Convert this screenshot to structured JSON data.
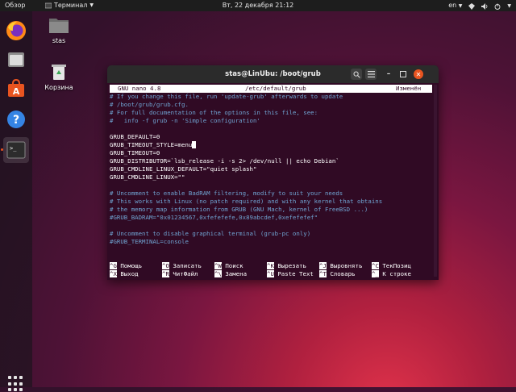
{
  "topbar": {
    "overview": "Обзор",
    "app_name": "Терминал",
    "clock": "Вт, 22 декабря  21:12",
    "lang": "en"
  },
  "desktop": {
    "home_label": "stas",
    "trash_label": "Корзина"
  },
  "window": {
    "title": "stas@LinUbu: /boot/grub"
  },
  "nano": {
    "version": "GNU nano 4.8",
    "file": "/etc/default/grub",
    "status": "Изменён",
    "lines": [
      "# If you change this file, run 'update-grub' afterwards to update",
      "# /boot/grub/grub.cfg.",
      "# For full documentation of the options in this file, see:",
      "#   info -f grub -n 'Simple configuration'",
      "",
      "GRUB_DEFAULT=0",
      "GRUB_TIMEOUT_STYLE=menu",
      "GRUB_TIMEOUT=0",
      "GRUB_DISTRIBUTOR=`lsb_release -i -s 2> /dev/null || echo Debian`",
      "GRUB_CMDLINE_LINUX_DEFAULT=\"quiet splash\"",
      "GRUB_CMDLINE_LINUX=\"\"",
      "",
      "# Uncomment to enable BadRAM filtering, modify to suit your needs",
      "# This works with Linux (no patch required) and with any kernel that obtains",
      "# the memory map information from GRUB (GNU Mach, kernel of FreeBSD ...)",
      "#GRUB_BADRAM=\"0x01234567,0xfefefefe,0x89abcdef,0xefefefef\"",
      "",
      "# Uncomment to disable graphical terminal (grub-pc only)",
      "#GRUB_TERMINAL=console"
    ],
    "shortcuts_row1": [
      {
        "key": "^G",
        "label": "Помощь"
      },
      {
        "key": "^O",
        "label": "Записать"
      },
      {
        "key": "^W",
        "label": "Поиск"
      },
      {
        "key": "^K",
        "label": "Вырезать"
      },
      {
        "key": "^J",
        "label": "Выровнять"
      },
      {
        "key": "^C",
        "label": "ТекПозиц"
      }
    ],
    "shortcuts_row2": [
      {
        "key": "^X",
        "label": "Выход"
      },
      {
        "key": "^R",
        "label": "ЧитФайл"
      },
      {
        "key": "^\\",
        "label": "Замена"
      },
      {
        "key": "^U",
        "label": "Paste Text"
      },
      {
        "key": "^T",
        "label": "Словарь"
      },
      {
        "key": "^_",
        "label": "К строке"
      }
    ]
  },
  "colors": {
    "terminal_bg": "#300a24",
    "accent": "#e95420",
    "comment": "#6fa3d1"
  }
}
